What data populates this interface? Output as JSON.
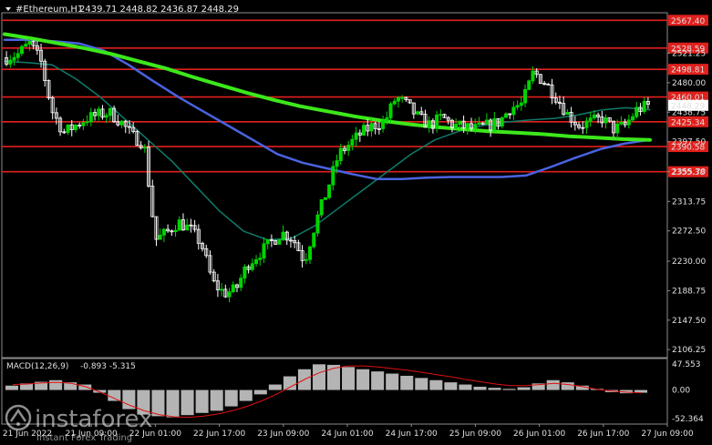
{
  "header": {
    "symbol": "#Ethereum,H1",
    "ohlc": "2439.71 2448.82 2436.87 2448.29"
  },
  "watermark": {
    "brand": "instaforex",
    "tagline": "Instant Forex Trading"
  },
  "colors": {
    "background": "#000000",
    "bull_candle": "#00d400",
    "bear_candle": "#ffffff",
    "level_line": "#e0201c",
    "ma_fast": "#0f7a6a",
    "ma_mid": "#4a63e0",
    "ma_slow": "#3ce81a",
    "macd_hist": "#b4b4b4",
    "macd_signal": "#e01010"
  },
  "chart_data": {
    "type": "candlestick",
    "instrument": "#Ethereum",
    "timeframe": "H1",
    "y_ticks": [
      "2521.25",
      "2480.00",
      "2438.75",
      "2397.50",
      "2355.70",
      "2313.75",
      "2272.50",
      "2230.00",
      "2188.75",
      "2147.50",
      "2106.25"
    ],
    "y_range": [
      2095,
      2578
    ],
    "x_ticks": [
      "21 Jun 2022",
      "21 Jun 09:00",
      "22 Jun 01:00",
      "22 Jun 17:00",
      "23 Jun 09:00",
      "24 Jun 01:00",
      "24 Jun 17:00",
      "25 Jun 09:00",
      "26 Jun 01:00",
      "26 Jun 17:00",
      "27 Jun 09:00"
    ],
    "current_price": "2448.29",
    "levels": [
      {
        "label": "2567.40",
        "value": 2567.4
      },
      {
        "label": "2528.59",
        "value": 2528.59
      },
      {
        "label": "2498.81",
        "value": 2498.81
      },
      {
        "label": "2460.01",
        "value": 2460.01
      },
      {
        "label": "2425.34",
        "value": 2425.34
      },
      {
        "label": "2390.58",
        "value": 2390.58
      },
      {
        "label": "2355.38",
        "value": 2355.38
      }
    ],
    "price_path": [
      2515,
      2520,
      2535,
      2510,
      2440,
      2410,
      2420,
      2430,
      2435,
      2438,
      2425,
      2405,
      2395,
      2260,
      2270,
      2285,
      2275,
      2255,
      2200,
      2185,
      2190,
      2225,
      2240,
      2255,
      2270,
      2262,
      2230,
      2285,
      2330,
      2380,
      2395,
      2410,
      2420,
      2425,
      2460,
      2448,
      2430,
      2420,
      2432,
      2420,
      2418,
      2415,
      2420,
      2425,
      2445,
      2450,
      2495,
      2480,
      2460,
      2435,
      2420,
      2425,
      2430,
      2415,
      2420,
      2442,
      2448
    ],
    "ma_fast": [
      2510,
      2508,
      2505,
      2485,
      2460,
      2430,
      2400,
      2370,
      2335,
      2300,
      2272,
      2260,
      2262,
      2280,
      2305,
      2330,
      2355,
      2380,
      2400,
      2412,
      2420,
      2425,
      2428,
      2430,
      2435,
      2442,
      2445,
      2442
    ],
    "ma_mid": [
      2540,
      2540,
      2538,
      2535,
      2525,
      2505,
      2482,
      2460,
      2440,
      2420,
      2400,
      2380,
      2368,
      2360,
      2352,
      2345,
      2345,
      2347,
      2348,
      2348,
      2348,
      2350,
      2362,
      2375,
      2387,
      2395,
      2400
    ],
    "ma_slow": [
      2548,
      2542,
      2535,
      2528,
      2520,
      2510,
      2500,
      2488,
      2477,
      2466,
      2456,
      2447,
      2440,
      2433,
      2427,
      2422,
      2418,
      2415,
      2412,
      2410,
      2408,
      2405,
      2403,
      2401,
      2400
    ],
    "macd": {
      "label": "MACD(12,26,9)",
      "values": "-0.893 -5.315",
      "y_ticks": [
        "47.553",
        "0.00",
        "-52.364"
      ],
      "y_range": [
        -52.364,
        47.553
      ],
      "histogram": [
        8,
        12,
        15,
        18,
        14,
        10,
        -5,
        -20,
        -35,
        -45,
        -48,
        -50,
        -46,
        -42,
        -38,
        -30,
        -20,
        -8,
        10,
        25,
        38,
        47,
        46,
        42,
        38,
        34,
        30,
        26,
        22,
        18,
        14,
        10,
        6,
        4,
        2,
        5,
        12,
        18,
        14,
        8,
        2,
        -4,
        -6,
        -5
      ],
      "signal": [
        10,
        11,
        13,
        14,
        12,
        6,
        -4,
        -16,
        -28,
        -38,
        -45,
        -49,
        -50,
        -48,
        -44,
        -38,
        -30,
        -20,
        -8,
        6,
        20,
        32,
        40,
        44,
        44,
        42,
        39,
        36,
        32,
        28,
        24,
        19,
        15,
        11,
        8,
        8,
        10,
        12,
        10,
        6,
        1,
        -2,
        -4,
        -5
      ]
    }
  }
}
